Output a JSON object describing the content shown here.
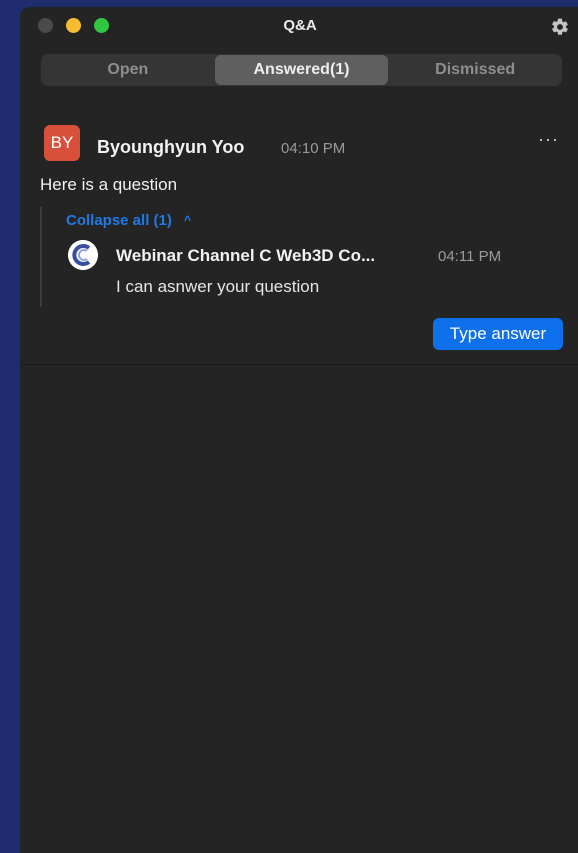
{
  "window": {
    "title": "Q&A"
  },
  "tabs": [
    {
      "label": "Open"
    },
    {
      "label": "Answered(1)"
    },
    {
      "label": "Dismissed"
    }
  ],
  "question": {
    "avatar_initials": "BY",
    "author": "Byounghyun Yoo",
    "time": "04:10 PM",
    "more_label": "···",
    "text": "Here is a question",
    "collapse_label": "Collapse all (1)",
    "collapse_chevron": "^",
    "answer": {
      "author": "Webinar Channel C Web3D Co...",
      "time": "04:11 PM",
      "text": "I can asnwer your question"
    },
    "type_answer_label": "Type answer"
  },
  "colors": {
    "background": "#1f2d6e",
    "window": "#242424",
    "accent": "#0e71eb",
    "link": "#1f7ae6",
    "avatar": "#d9503a"
  },
  "icons": {
    "settings": "gear-icon",
    "answer_avatar": "webinar-logo-icon"
  }
}
